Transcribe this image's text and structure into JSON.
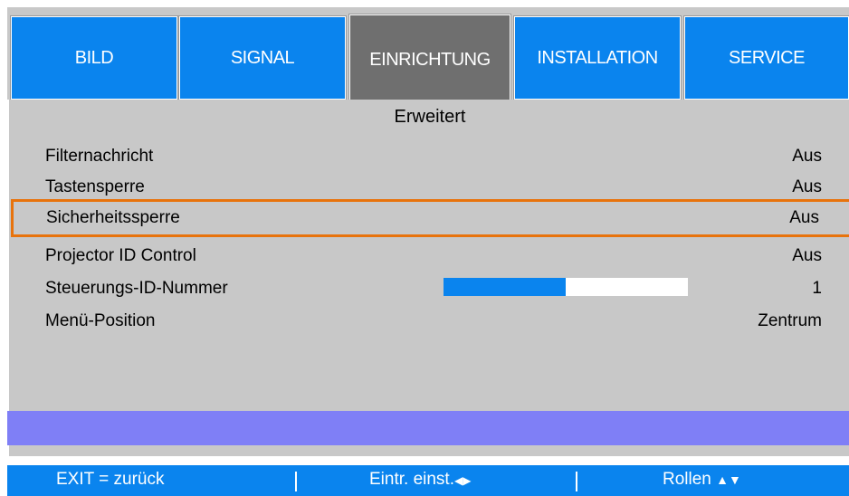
{
  "tabs": [
    {
      "label": "BILD"
    },
    {
      "label": "SIGNAL"
    },
    {
      "label": "EINRICHTUNG"
    },
    {
      "label": "INSTALLATION"
    },
    {
      "label": "SERVICE"
    }
  ],
  "active_tab": "EINRICHTUNG",
  "section_title": "Erweitert",
  "rows": [
    {
      "label": "Filternachricht",
      "value": "Aus"
    },
    {
      "label": "Tastensperre",
      "value": "Aus"
    },
    {
      "label": "Sicherheitssperre",
      "value": "Aus",
      "selected": true
    },
    {
      "label": "Projector ID Control",
      "value": "Aus"
    },
    {
      "label": "Steuerungs-ID-Nummer",
      "value": "1",
      "slider_fraction": 0.5
    },
    {
      "label": "Menü-Position",
      "value": "Zentrum"
    }
  ],
  "footer": {
    "exit": "EXIT = zurück",
    "adjust": "Eintr. einst.",
    "adjust_icon": "◀▶",
    "scroll": "Rollen",
    "scroll_icon": "▲▼"
  },
  "colors": {
    "tab_blue": "#0a84ee",
    "tab_active": "#6f6f6f",
    "panel_gray": "#c8c8c8",
    "selection_orange": "#e8730c",
    "hint_bar": "#7f7ff6"
  }
}
